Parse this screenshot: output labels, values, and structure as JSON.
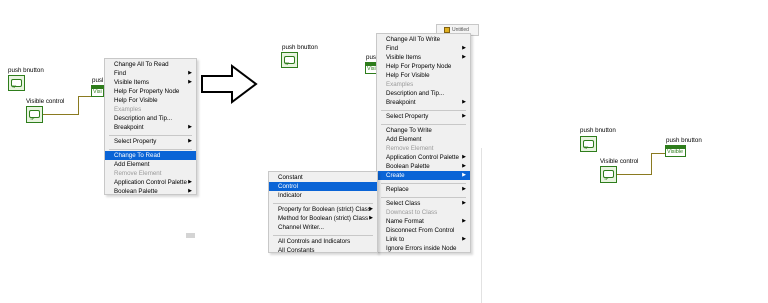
{
  "panel1": {
    "push_button_label": "push bnutton",
    "visible_control_label": "Visible control",
    "push_short_label": "pusl",
    "visible_short": "Visi",
    "menu": [
      {
        "label": "Change All To Read",
        "arrow": ""
      },
      {
        "label": "Find",
        "arrow": "▶"
      },
      {
        "label": "Visible Items",
        "arrow": "▶"
      },
      {
        "label": "Help For Property Node",
        "arrow": ""
      },
      {
        "label": "Help For Visible",
        "arrow": ""
      },
      {
        "label": "Examples",
        "arrow": ""
      },
      {
        "label": "Description and Tip...",
        "arrow": ""
      },
      {
        "label": "Breakpoint",
        "arrow": "▶"
      },
      {
        "label": "Select Property",
        "arrow": "▶"
      },
      {
        "label": "Change To Read",
        "arrow": ""
      },
      {
        "label": "Add Element",
        "arrow": ""
      },
      {
        "label": "Remove Element",
        "arrow": ""
      },
      {
        "label": "Application Control Palette",
        "arrow": "▶"
      },
      {
        "label": "Boolean Palette",
        "arrow": "▶"
      }
    ]
  },
  "arrow_glyph": "⇨",
  "panel2": {
    "push_button_label": "push bnutton",
    "push_short_label": "push",
    "visible_short": "Visi",
    "window_title": "Untitled",
    "main_menu": [
      {
        "label": "Change All To Write",
        "arrow": ""
      },
      {
        "label": "Find",
        "arrow": "▶"
      },
      {
        "label": "Visible Items",
        "arrow": "▶"
      },
      {
        "label": "Help For Property Node",
        "arrow": ""
      },
      {
        "label": "Help For Visible",
        "arrow": ""
      },
      {
        "label": "Examples",
        "arrow": ""
      },
      {
        "label": "Description and Tip...",
        "arrow": ""
      },
      {
        "label": "Breakpoint",
        "arrow": "▶"
      },
      {
        "label": "Select Property",
        "arrow": "▶"
      },
      {
        "label": "Change To Write",
        "arrow": ""
      },
      {
        "label": "Add Element",
        "arrow": ""
      },
      {
        "label": "Remove Element",
        "arrow": ""
      },
      {
        "label": "Application Control Palette",
        "arrow": "▶"
      },
      {
        "label": "Boolean Palette",
        "arrow": "▶"
      },
      {
        "label": "Create",
        "arrow": "▶"
      },
      {
        "label": "Replace",
        "arrow": "▶"
      },
      {
        "label": "Select Class",
        "arrow": "▶"
      },
      {
        "label": "Downcast to Class",
        "arrow": ""
      },
      {
        "label": "Name Format",
        "arrow": "▶"
      },
      {
        "label": "Disconnect From Control",
        "arrow": ""
      },
      {
        "label": "Link to",
        "arrow": "▶"
      },
      {
        "label": "Ignore Errors inside Node",
        "arrow": ""
      }
    ],
    "sub_menu": [
      {
        "label": "Constant",
        "arrow": ""
      },
      {
        "label": "Control",
        "arrow": ""
      },
      {
        "label": "Indicator",
        "arrow": ""
      },
      {
        "label": "Property for Boolean (strict) Class",
        "arrow": "▶"
      },
      {
        "label": "Method for Boolean (strict) Class",
        "arrow": "▶"
      },
      {
        "label": "Channel Writer...",
        "arrow": ""
      },
      {
        "label": "All Controls and Indicators",
        "arrow": ""
      },
      {
        "label": "All Constants",
        "arrow": ""
      }
    ]
  },
  "panel3": {
    "push_button_label": "push bnutton",
    "push_short_label": "push bnutton",
    "visible_control_label": "Visible control",
    "visible_node_text": "Visible"
  },
  "terminal_tf": "TF"
}
